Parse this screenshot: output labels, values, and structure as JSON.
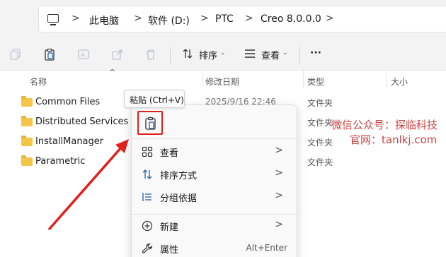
{
  "address_bar": {
    "breadcrumbs": [
      "此电脑",
      "软件 (D:)",
      "PTC",
      "Creo 8.0.0.0"
    ],
    "separator": ">"
  },
  "toolbar": {
    "sort_label": "排序",
    "view_label": "查看",
    "more_label": "···"
  },
  "columns": {
    "name": "名称",
    "date": "修改日期",
    "type": "类型",
    "size": "大小"
  },
  "files": [
    {
      "name": "Common Files",
      "date": "2025/9/16 22:46",
      "type": "文件夹"
    },
    {
      "name": "Distributed Services Ma",
      "date": "",
      "type": "文件夹"
    },
    {
      "name": "InstallManager",
      "date": "",
      "type": "文件夹"
    },
    {
      "name": "Parametric",
      "date": "",
      "type": "文件夹"
    }
  ],
  "tooltip": {
    "text": "粘贴 (Ctrl+V)"
  },
  "context_menu": {
    "items": [
      {
        "label": "查看",
        "icon": "grid-icon",
        "arrow": ">"
      },
      {
        "label": "排序方式",
        "icon": "sort-icon",
        "arrow": ">"
      },
      {
        "label": "分组依据",
        "icon": "group-icon",
        "arrow": ">"
      },
      {
        "label": "新建",
        "icon": "plus-circle-icon",
        "arrow": ">"
      },
      {
        "label": "属性",
        "icon": "wrench-icon",
        "shortcut": "Alt+Enter"
      }
    ]
  },
  "watermark": {
    "line1": "微信公众号：探临科技",
    "line2": "官网：tanlkj.com"
  },
  "colors": {
    "highlight_red": "#e0201b",
    "folder_yellow": "#f5c547",
    "accent_blue": "#1a5fb4"
  }
}
